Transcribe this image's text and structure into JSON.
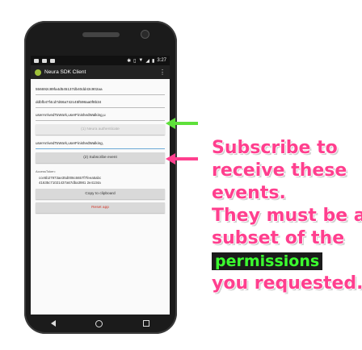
{
  "status_bar": {
    "time": "3:27"
  },
  "app_bar": {
    "title": "Neura SDK Client"
  },
  "fields": {
    "app_uid": "556692c89fa4d545137db40dd43c902aa",
    "app_secret": "ddbfb47f4cd7d66a742c45f598aa0f8b34",
    "permissions": "userArrivedToWork,userFinishedWalking,u",
    "subscribe_events": "userArrivedToWork,userFinishedWalking,"
  },
  "buttons": {
    "authenticate": "(1) Neura authenticate",
    "subscribe": "(2) Subscribe event",
    "copy": "Copy to clipboard",
    "reset": "Reset app"
  },
  "token": {
    "label": "AccessToken:",
    "line1": "cce5b27973ae35d006c6657f7feea5abc",
    "line2": "41635c71021437a67dba3981 2e4134a"
  },
  "callout": {
    "line1": "Subscribe to",
    "line2": "receive these",
    "line3": "events.",
    "line4": "They must be a",
    "line5": "subset of the",
    "highlight": "permissions",
    "line6": "you requested."
  },
  "colors": {
    "green_arrow": "#5ee03a",
    "pink_arrow": "#ff3f8e",
    "callout": "#ff3f8e"
  }
}
